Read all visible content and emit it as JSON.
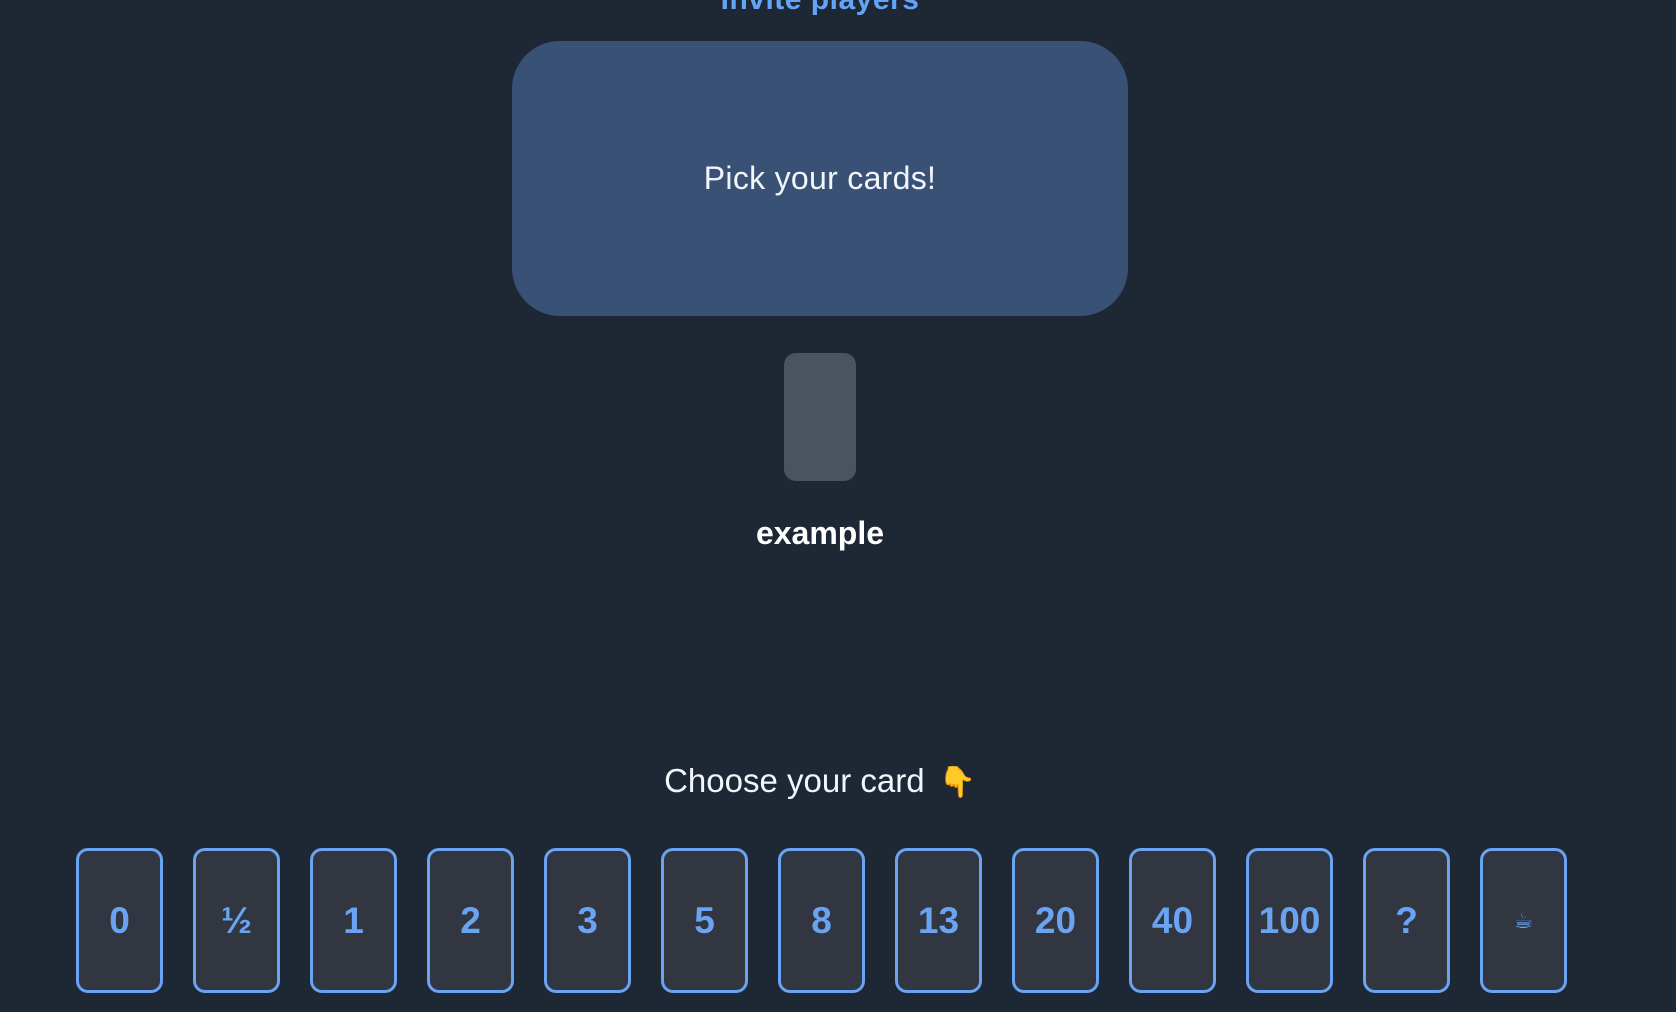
{
  "header": {
    "invite_label": "Invite players"
  },
  "table": {
    "message": "Pick your cards!"
  },
  "player": {
    "name": "example"
  },
  "prompt": {
    "text": "Choose your card",
    "emoji": "👇"
  },
  "deck": {
    "cards": [
      "0",
      "½",
      "1",
      "2",
      "3",
      "5",
      "8",
      "13",
      "20",
      "40",
      "100",
      "?",
      "☕"
    ]
  },
  "colors": {
    "background": "#1e2835",
    "table": "#385175",
    "accent": "#6aa3f2",
    "card_background": "#313640",
    "player_card": "#4a545e"
  }
}
